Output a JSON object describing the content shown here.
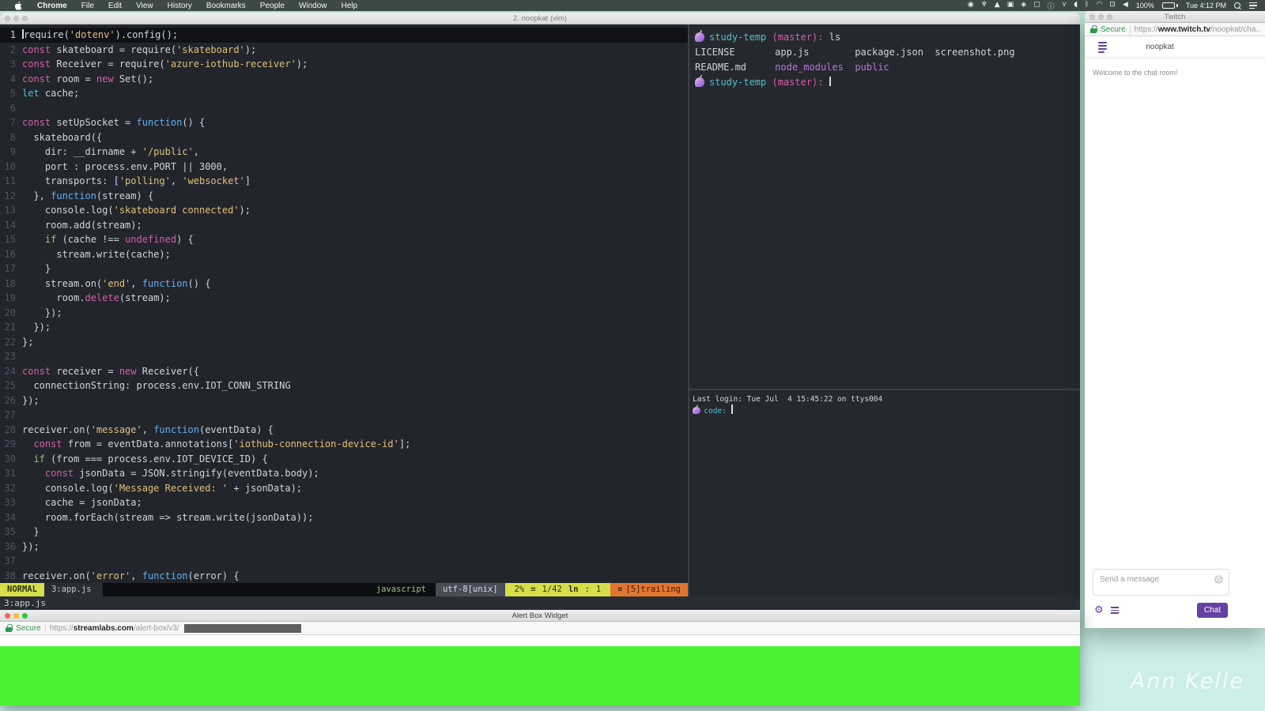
{
  "menu_bar": {
    "items": [
      "Chrome",
      "File",
      "Edit",
      "View",
      "History",
      "Bookmarks",
      "People",
      "Window",
      "Help"
    ],
    "status_icons": [
      "◉",
      "♆",
      "▲",
      "▣",
      "◈",
      "▢",
      "ⓘ",
      "⋎",
      "◖",
      "ᛒ",
      "◠",
      "⊡",
      "◀"
    ],
    "battery_label": "100%",
    "clock": "Tue 4:12 PM"
  },
  "desktop": {
    "signature": "Ann Kelle"
  },
  "terminal_window": {
    "title": "2. noopkat (vim)",
    "tmux_status": "3:app.js",
    "vim": {
      "lines": [
        {
          "n": 1,
          "cur": true,
          "t": [
            [
              "cur",
              ""
            ],
            [
              "w",
              "require("
            ],
            [
              "s",
              "'dotenv'"
            ],
            [
              "w",
              ").config();"
            ]
          ]
        },
        {
          "n": 2,
          "t": [
            [
              "k",
              "const"
            ],
            [
              "w",
              " skateboard = require("
            ],
            [
              "s",
              "'skateboard'"
            ],
            [
              "w",
              ");"
            ]
          ]
        },
        {
          "n": 3,
          "t": [
            [
              "k",
              "const"
            ],
            [
              "w",
              " Receiver = require("
            ],
            [
              "s",
              "'azure-iothub-receiver'"
            ],
            [
              "w",
              ");"
            ]
          ]
        },
        {
          "n": 4,
          "t": [
            [
              "k",
              "const"
            ],
            [
              "w",
              " room = "
            ],
            [
              "k",
              "new"
            ],
            [
              "w",
              " Set();"
            ]
          ]
        },
        {
          "n": 5,
          "t": [
            [
              "c",
              "let"
            ],
            [
              "w",
              " cache;"
            ]
          ]
        },
        {
          "n": 6,
          "t": []
        },
        {
          "n": 7,
          "t": [
            [
              "k",
              "const"
            ],
            [
              "w",
              " setUpSocket = "
            ],
            [
              "b",
              "function"
            ],
            [
              "w",
              "() {"
            ]
          ]
        },
        {
          "n": 8,
          "t": [
            [
              "w",
              "  skateboard({"
            ]
          ]
        },
        {
          "n": 9,
          "t": [
            [
              "w",
              "    dir: __dirname + "
            ],
            [
              "s",
              "'/public'"
            ],
            [
              "w",
              ","
            ]
          ]
        },
        {
          "n": 10,
          "t": [
            [
              "w",
              "    port : process.env.PORT || 3000,"
            ]
          ]
        },
        {
          "n": 11,
          "t": [
            [
              "w",
              "    transports: ["
            ],
            [
              "s",
              "'polling'"
            ],
            [
              "w",
              ", "
            ],
            [
              "s",
              "'websocket'"
            ],
            [
              "w",
              "]"
            ]
          ]
        },
        {
          "n": 12,
          "t": [
            [
              "w",
              "  }, "
            ],
            [
              "b",
              "function"
            ],
            [
              "w",
              "(stream) {"
            ]
          ]
        },
        {
          "n": 13,
          "t": [
            [
              "w",
              "    console.log("
            ],
            [
              "s",
              "'skateboard connected'"
            ],
            [
              "w",
              ");"
            ]
          ]
        },
        {
          "n": 14,
          "t": [
            [
              "w",
              "    room.add(stream);"
            ]
          ]
        },
        {
          "n": 15,
          "t": [
            [
              "w",
              "    "
            ],
            [
              "g",
              "if"
            ],
            [
              "w",
              " (cache !== "
            ],
            [
              "k",
              "undefined"
            ],
            [
              "w",
              ") {"
            ]
          ]
        },
        {
          "n": 16,
          "t": [
            [
              "w",
              "      stream.write(cache);"
            ]
          ]
        },
        {
          "n": 17,
          "t": [
            [
              "w",
              "    }"
            ]
          ]
        },
        {
          "n": 18,
          "t": [
            [
              "w",
              "    stream.on("
            ],
            [
              "s",
              "'end'"
            ],
            [
              "w",
              ", "
            ],
            [
              "b",
              "function"
            ],
            [
              "w",
              "() {"
            ]
          ]
        },
        {
          "n": 19,
          "t": [
            [
              "w",
              "      room."
            ],
            [
              "k",
              "delete"
            ],
            [
              "w",
              "(stream);"
            ]
          ]
        },
        {
          "n": 20,
          "t": [
            [
              "w",
              "    });"
            ]
          ]
        },
        {
          "n": 21,
          "t": [
            [
              "w",
              "  });"
            ]
          ]
        },
        {
          "n": 22,
          "t": [
            [
              "w",
              "};"
            ]
          ]
        },
        {
          "n": 23,
          "t": []
        },
        {
          "n": 24,
          "t": [
            [
              "k",
              "const"
            ],
            [
              "w",
              " receiver = "
            ],
            [
              "k",
              "new"
            ],
            [
              "w",
              " Receiver({"
            ]
          ]
        },
        {
          "n": 25,
          "t": [
            [
              "w",
              "  connectionString: process.env.IOT_CONN_STRING"
            ]
          ]
        },
        {
          "n": 26,
          "t": [
            [
              "w",
              "});"
            ]
          ]
        },
        {
          "n": 27,
          "t": []
        },
        {
          "n": 28,
          "t": [
            [
              "w",
              "receiver.on("
            ],
            [
              "s",
              "'message'"
            ],
            [
              "w",
              ", "
            ],
            [
              "b",
              "function"
            ],
            [
              "w",
              "(eventData) {"
            ]
          ]
        },
        {
          "n": 29,
          "t": [
            [
              "w",
              "  "
            ],
            [
              "k",
              "const"
            ],
            [
              "w",
              " from = eventData.annotations["
            ],
            [
              "s",
              "'iothub-connection-device-id'"
            ],
            [
              "w",
              "];"
            ]
          ]
        },
        {
          "n": 30,
          "t": [
            [
              "w",
              "  "
            ],
            [
              "g",
              "if"
            ],
            [
              "w",
              " (from === process.env.IOT_DEVICE_ID) {"
            ]
          ]
        },
        {
          "n": 31,
          "t": [
            [
              "w",
              "    "
            ],
            [
              "k",
              "const"
            ],
            [
              "w",
              " jsonData = JSON.stringify(eventData.body);"
            ]
          ]
        },
        {
          "n": 32,
          "t": [
            [
              "w",
              "    console.log("
            ],
            [
              "s",
              "'Message Received: '"
            ],
            [
              "w",
              " + jsonData);"
            ]
          ]
        },
        {
          "n": 33,
          "t": [
            [
              "w",
              "    cache = jsonData;"
            ]
          ]
        },
        {
          "n": 34,
          "t": [
            [
              "w",
              "    room.forEach(stream => stream.write(jsonData));"
            ]
          ]
        },
        {
          "n": 35,
          "t": [
            [
              "w",
              "  }"
            ]
          ]
        },
        {
          "n": 36,
          "t": [
            [
              "w",
              "});"
            ]
          ]
        },
        {
          "n": 37,
          "t": []
        },
        {
          "n": 38,
          "t": [
            [
              "w",
              "receiver.on("
            ],
            [
              "s",
              "'error'"
            ],
            [
              "w",
              ", "
            ],
            [
              "b",
              "function"
            ],
            [
              "w",
              "(error) {"
            ]
          ]
        }
      ],
      "statusline": {
        "mode": "NORMAL",
        "buffer": "3:app.js",
        "filetype": "javascript",
        "encoding": "utf-8[unix]",
        "percent": "2%",
        "list_glyph": "≡",
        "position": "1/42",
        "ln_label": "ln",
        "colon": ":",
        "col": "1",
        "warn_glyph": "≡",
        "warning": "[5]trailing"
      }
    },
    "shell_top": {
      "lines": [
        {
          "t": [
            [
              "u",
              ""
            ],
            [
              "c",
              "study-temp "
            ],
            [
              "k",
              "(master):"
            ],
            [
              "w",
              " ls"
            ]
          ]
        },
        {
          "t": [
            [
              "w",
              "LICENSE       app.js        package.json  screenshot.png"
            ]
          ]
        },
        {
          "t": [
            [
              "w",
              "README.md     "
            ],
            [
              "p",
              "node_modules"
            ],
            [
              "w",
              "  "
            ],
            [
              "p",
              "public"
            ]
          ]
        },
        {
          "t": [
            [
              "u",
              ""
            ],
            [
              "c",
              "study-temp "
            ],
            [
              "k",
              "(master): "
            ],
            [
              "cur",
              ""
            ]
          ]
        }
      ]
    },
    "shell_bottom": {
      "lines": [
        {
          "t": [
            [
              "w",
              "Last login: Tue Jul  4 15:45:22 on ttys004"
            ]
          ]
        },
        {
          "t": [
            [
              "u",
              ""
            ],
            [
              "c",
              "code: "
            ],
            [
              "cur",
              ""
            ]
          ]
        }
      ]
    }
  },
  "twitch_window": {
    "title": "Twitch",
    "url": {
      "secure": "Secure",
      "prefix": "https://",
      "domain": "www.twitch.tv",
      "path": "/noopkat/cha..."
    },
    "chat": {
      "channel": "noopkat",
      "welcome": "Welcome to the chat room!",
      "placeholder": "Send a message",
      "send_label": "Chat"
    }
  },
  "alert_window": {
    "title": "Alert Box Widget",
    "url": {
      "secure": "Secure",
      "prefix": "https://",
      "domain": "streamlabs.com",
      "path": "/alert-box/v3/"
    },
    "green_color": "#4bf234"
  }
}
